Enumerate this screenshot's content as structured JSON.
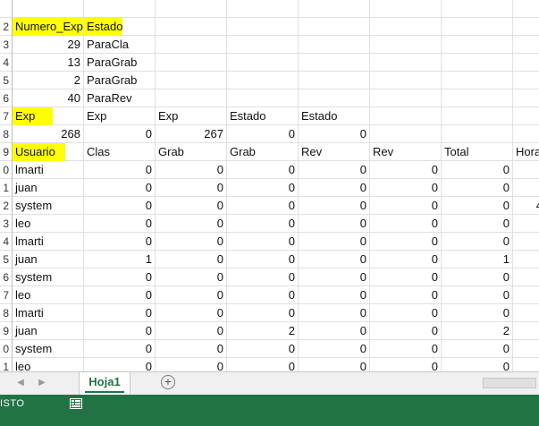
{
  "row_numbers": [
    "2",
    "3",
    "4",
    "5",
    "6",
    "7",
    "8",
    "9",
    "0",
    "1",
    "2",
    "3",
    "4",
    "5",
    "6",
    "7",
    "8",
    "9",
    "0",
    "1"
  ],
  "row1": {
    "c1": "Numero_Exp",
    "c2": "Estado"
  },
  "row2": {
    "a": "29",
    "b": "ParaCla"
  },
  "row3": {
    "a": "13",
    "b": "ParaGrab"
  },
  "row4": {
    "a": "2",
    "b": "ParaGrab"
  },
  "row5": {
    "a": "40",
    "b": "ParaRev"
  },
  "row6": {
    "c1": "Exp",
    "c2": "Exp",
    "c3": "Exp",
    "c4": "Estado",
    "c5": "Estado"
  },
  "row7": {
    "c1": "268",
    "c2": "0",
    "c3": "267",
    "c4": "0",
    "c5": "0"
  },
  "row8": {
    "c1": "Usuario",
    "c2": "Clas",
    "c3": "Grab",
    "c4": "Grab",
    "c5": "Rev",
    "c6": "Rev",
    "c7": "Total",
    "c8": "Hora"
  },
  "users": [
    {
      "name": "lmarti",
      "v": [
        "0",
        "0",
        "0",
        "0",
        "0",
        "0"
      ]
    },
    {
      "name": "juan",
      "v": [
        "0",
        "0",
        "0",
        "0",
        "0",
        "0"
      ]
    },
    {
      "name": "system",
      "v": [
        "0",
        "0",
        "0",
        "0",
        "0",
        "0"
      ],
      "extra": "4"
    },
    {
      "name": "leo",
      "v": [
        "0",
        "0",
        "0",
        "0",
        "0",
        "0"
      ]
    },
    {
      "name": "lmarti",
      "v": [
        "0",
        "0",
        "0",
        "0",
        "0",
        "0"
      ]
    },
    {
      "name": "juan",
      "v": [
        "1",
        "0",
        "0",
        "0",
        "0",
        "1"
      ]
    },
    {
      "name": "system",
      "v": [
        "0",
        "0",
        "0",
        "0",
        "0",
        "0"
      ]
    },
    {
      "name": "leo",
      "v": [
        "0",
        "0",
        "0",
        "0",
        "0",
        "0"
      ]
    },
    {
      "name": "lmarti",
      "v": [
        "0",
        "0",
        "0",
        "0",
        "0",
        "0"
      ]
    },
    {
      "name": "juan",
      "v": [
        "0",
        "0",
        "2",
        "0",
        "0",
        "2"
      ]
    },
    {
      "name": "system",
      "v": [
        "0",
        "0",
        "0",
        "0",
        "0",
        "0"
      ]
    },
    {
      "name": "leo",
      "v": [
        "0",
        "0",
        "0",
        "0",
        "0",
        "0"
      ]
    }
  ],
  "tabs": {
    "sheet_name": "Hoja1",
    "add_glyph": "+",
    "prev_glyph": "◀",
    "next_glyph": "▶"
  },
  "status": {
    "text": "ISTO"
  },
  "colors": {
    "highlight": "#ffff00",
    "excel_green": "#217346",
    "gridline": "#e0e0e0"
  },
  "icons": {
    "macro": "macro-record-icon",
    "add": "new-sheet-icon"
  }
}
